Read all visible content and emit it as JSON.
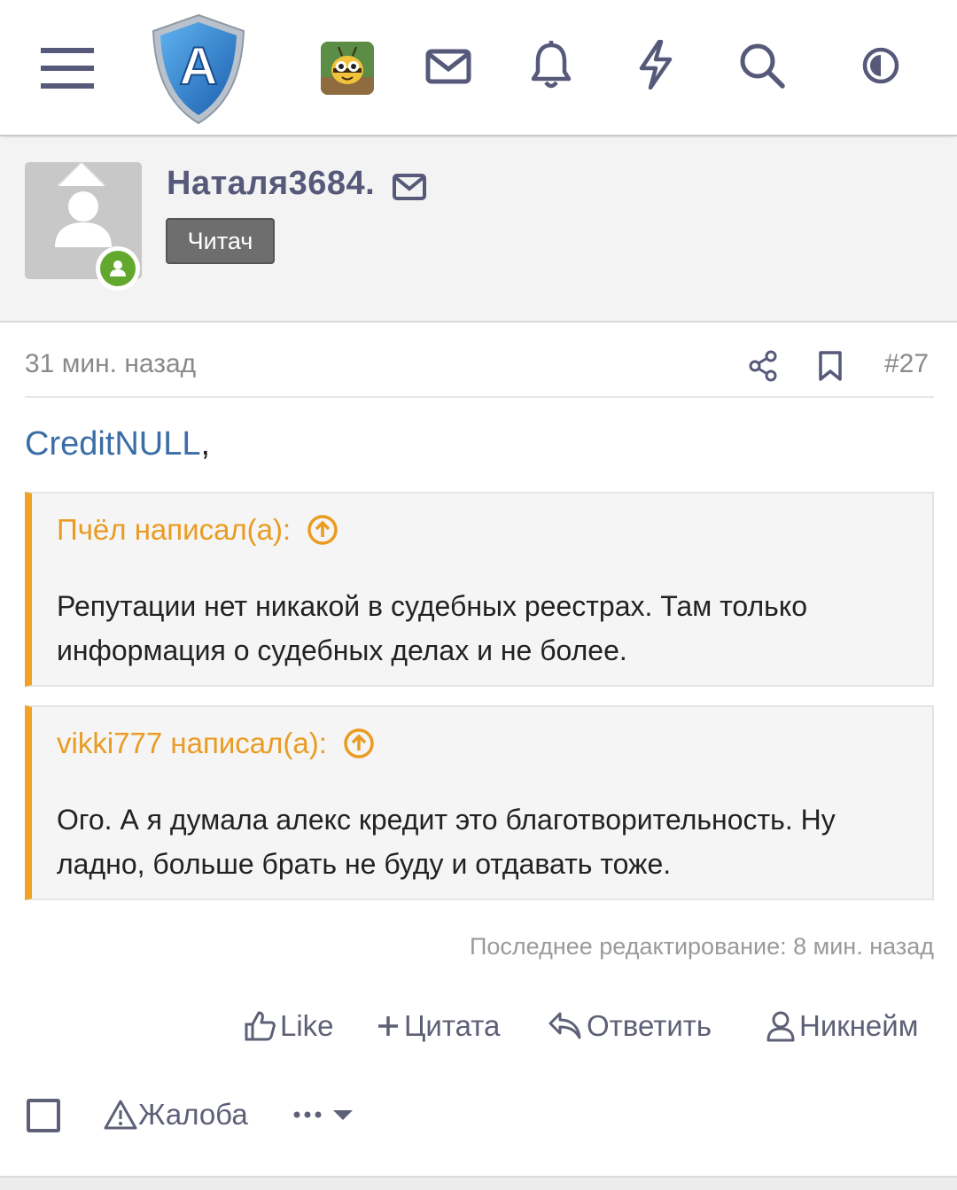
{
  "nav": {
    "icons": [
      "menu-icon",
      "shield-logo",
      "user-avatar",
      "mail-icon",
      "bell-icon",
      "lightning-icon",
      "search-icon",
      "theme-toggle-icon"
    ],
    "logo_letter": "A"
  },
  "author": {
    "username": "Наталя3684.",
    "role": "Читач",
    "online": true
  },
  "post": {
    "time": "31 мин. назад",
    "number": "#27",
    "mention": "CreditNULL",
    "mention_suffix": ",",
    "quotes": [
      {
        "header": "Пчёл написал(а):",
        "text": "Репутации нет никакой в судебных реестрах. Там только информация о судебных делах и не более."
      },
      {
        "header": "vikki777 написал(а):",
        "text": "Ого. А я думала алекс кредит это благотворительность. Ну ладно, больше брать не буду и отдавать тоже."
      }
    ],
    "edited": "Последнее редактирование: 8 мин. назад"
  },
  "actions": {
    "like": "Like",
    "quote": "Цитата",
    "reply": "Ответить",
    "nickname": "Никнейм",
    "report": "Жалоба"
  },
  "colors": {
    "accent_nav": "#56597a",
    "quote_border": "#f0a126",
    "quote_text": "#ea9b22",
    "mention": "#3b6ea6",
    "online": "#63a82e"
  }
}
